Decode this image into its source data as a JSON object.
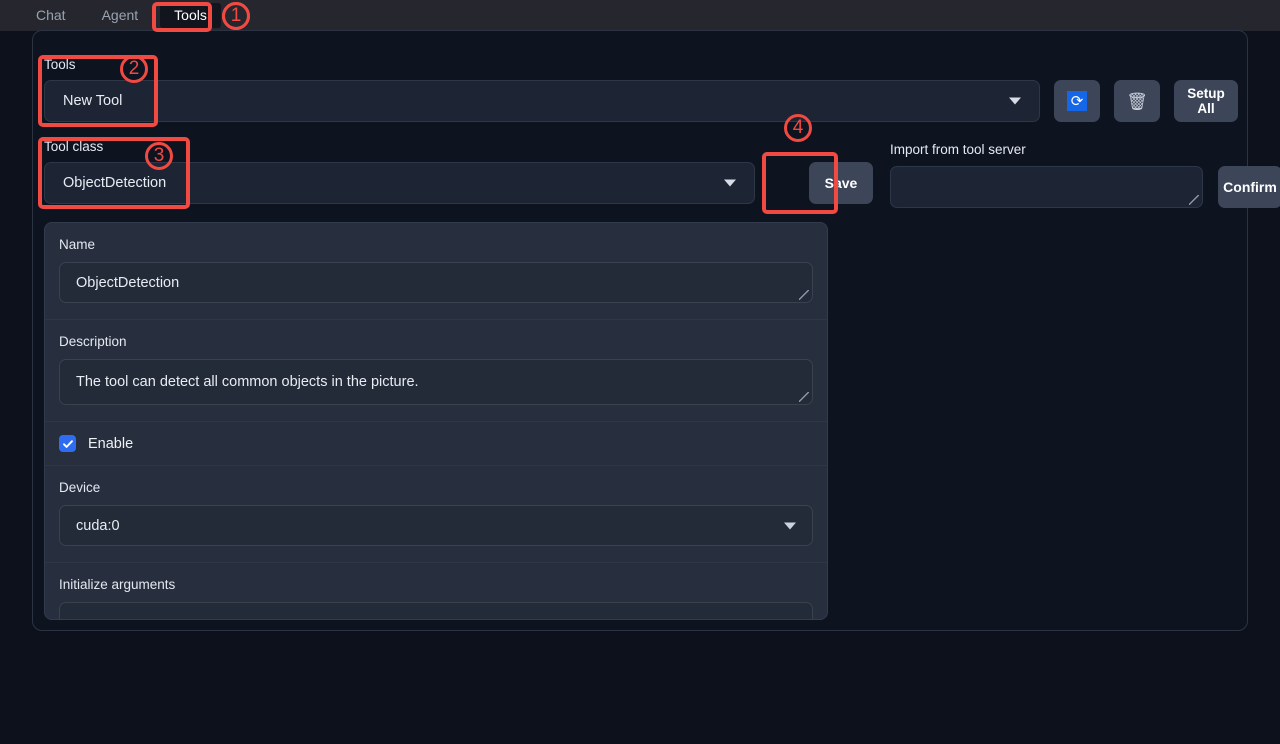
{
  "tabs": [
    {
      "label": "Chat",
      "active": false
    },
    {
      "label": "Agent",
      "active": false
    },
    {
      "label": "Tools",
      "active": true
    }
  ],
  "tools_row": {
    "label": "Tools",
    "selected": "New Tool",
    "refresh_icon": "refresh-icon",
    "trash_icon": "trash-icon",
    "setup_all_line1": "Setup",
    "setup_all_line2": "All"
  },
  "class_row": {
    "label": "Tool class",
    "selected": "ObjectDetection",
    "save_label": "Save",
    "import_label": "Import from tool server",
    "import_value": "",
    "confirm_label": "Confirm"
  },
  "form": {
    "name_label": "Name",
    "name_value": "ObjectDetection",
    "description_label": "Description",
    "description_value": "The tool can detect all common objects in the picture.",
    "enable_label": "Enable",
    "enable_checked": true,
    "device_label": "Device",
    "device_value": "cuda:0",
    "init_args_label": "Initialize arguments",
    "init_args_value": ""
  },
  "annotations": [
    {
      "number": "①"
    },
    {
      "number": "②"
    },
    {
      "number": "③"
    },
    {
      "number": "④"
    }
  ],
  "colors": {
    "annotation": "#f04a42",
    "accent_blue": "#2f6df0",
    "refresh_blue": "#1667e8",
    "panel": "#272e3d",
    "background": "#0d111c",
    "tabbar": "#25262e"
  }
}
